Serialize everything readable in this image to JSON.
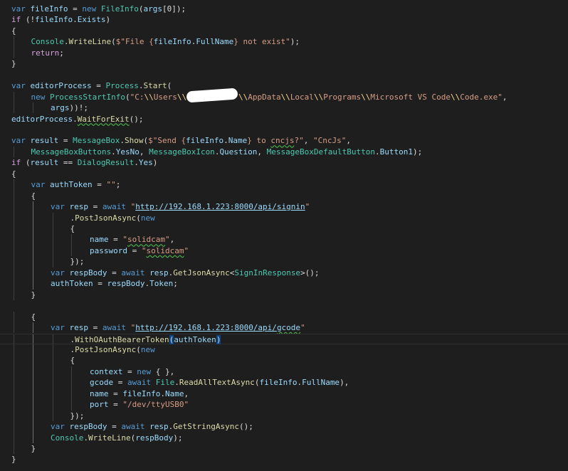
{
  "editor": {
    "lines": [
      {
        "i": 0,
        "t": [
          [
            "kw",
            "var "
          ],
          [
            "var",
            "fileInfo"
          ],
          [
            "def",
            " = "
          ],
          [
            "kw",
            "new "
          ],
          [
            "type",
            "FileInfo"
          ],
          [
            "def",
            "("
          ],
          [
            "var",
            "args"
          ],
          [
            "def",
            "[0]);"
          ]
        ]
      },
      {
        "i": 0,
        "t": [
          [
            "ctl",
            "if "
          ],
          [
            "def",
            "(!"
          ],
          [
            "var",
            "fileInfo"
          ],
          [
            "def",
            "."
          ],
          [
            "var",
            "Exists"
          ],
          [
            "def",
            ")"
          ]
        ]
      },
      {
        "i": 0,
        "t": [
          [
            "def",
            "{"
          ]
        ]
      },
      {
        "i": 1,
        "t": [
          [
            "type",
            "Console"
          ],
          [
            "def",
            "."
          ],
          [
            "meth",
            "WriteLine"
          ],
          [
            "def",
            "("
          ],
          [
            "str",
            "$\"File {"
          ],
          [
            "var",
            "fileInfo"
          ],
          [
            "def",
            "."
          ],
          [
            "var",
            "FullName"
          ],
          [
            "str",
            "} not exist\""
          ],
          [
            "def",
            ");"
          ]
        ]
      },
      {
        "i": 1,
        "t": [
          [
            "ctl",
            "return"
          ],
          [
            "def",
            ";"
          ]
        ]
      },
      {
        "i": 0,
        "t": [
          [
            "def",
            "}"
          ]
        ]
      },
      {
        "i": 0,
        "t": []
      },
      {
        "i": 0,
        "t": [
          [
            "kw",
            "var "
          ],
          [
            "var",
            "editorProcess"
          ],
          [
            "def",
            " = "
          ],
          [
            "type",
            "Process"
          ],
          [
            "def",
            "."
          ],
          [
            "meth",
            "Start"
          ],
          [
            "def",
            "("
          ]
        ]
      },
      {
        "i": 1,
        "t": [
          [
            "kw",
            "new "
          ],
          [
            "type",
            "ProcessStartInfo"
          ],
          [
            "def",
            "("
          ],
          [
            "str",
            "\"C:"
          ],
          [
            "esc",
            "\\\\"
          ],
          [
            "str",
            "Users"
          ],
          [
            "esc",
            "\\\\"
          ],
          [
            "str",
            "           "
          ],
          [
            "esc",
            "\\\\"
          ],
          [
            "str",
            "AppData"
          ],
          [
            "esc",
            "\\\\"
          ],
          [
            "str",
            "Local"
          ],
          [
            "esc",
            "\\\\"
          ],
          [
            "str",
            "Programs"
          ],
          [
            "esc",
            "\\\\"
          ],
          [
            "str",
            "Microsoft VS Code"
          ],
          [
            "esc",
            "\\\\"
          ],
          [
            "str",
            "Code.exe\""
          ],
          [
            "def",
            ","
          ]
        ]
      },
      {
        "i": 2,
        "t": [
          [
            "var",
            "args"
          ],
          [
            "def",
            "))!;"
          ]
        ]
      },
      {
        "i": 0,
        "t": [
          [
            "var",
            "editorProcess"
          ],
          [
            "def",
            "."
          ],
          [
            "meth",
            "WaitForExit",
            "squig"
          ],
          [
            "def",
            "();"
          ]
        ]
      },
      {
        "i": 0,
        "t": []
      },
      {
        "i": 0,
        "t": [
          [
            "kw",
            "var "
          ],
          [
            "var",
            "result"
          ],
          [
            "def",
            " = "
          ],
          [
            "type",
            "MessageBox"
          ],
          [
            "def",
            "."
          ],
          [
            "meth",
            "Show"
          ],
          [
            "def",
            "("
          ],
          [
            "str",
            "$\"Send {"
          ],
          [
            "var",
            "fileInfo"
          ],
          [
            "def",
            "."
          ],
          [
            "var",
            "Name"
          ],
          [
            "str",
            "} to "
          ],
          [
            "str",
            "cncjs",
            "squig"
          ],
          [
            "str",
            "?\""
          ],
          [
            "def",
            ", "
          ],
          [
            "str",
            "\"CncJs\""
          ],
          [
            "def",
            ","
          ]
        ]
      },
      {
        "i": 1,
        "t": [
          [
            "type",
            "MessageBoxButtons"
          ],
          [
            "def",
            "."
          ],
          [
            "var",
            "YesNo"
          ],
          [
            "def",
            ", "
          ],
          [
            "type",
            "MessageBoxIcon"
          ],
          [
            "def",
            "."
          ],
          [
            "var",
            "Question"
          ],
          [
            "def",
            ", "
          ],
          [
            "type",
            "MessageBoxDefaultButton"
          ],
          [
            "def",
            "."
          ],
          [
            "var",
            "Button1"
          ],
          [
            "def",
            ");"
          ]
        ]
      },
      {
        "i": 0,
        "t": [
          [
            "ctl",
            "if "
          ],
          [
            "def",
            "("
          ],
          [
            "var",
            "result"
          ],
          [
            "def",
            " == "
          ],
          [
            "type",
            "DialogResult"
          ],
          [
            "def",
            "."
          ],
          [
            "var",
            "Yes"
          ],
          [
            "def",
            ")"
          ]
        ]
      },
      {
        "i": 0,
        "t": [
          [
            "def",
            "{"
          ]
        ]
      },
      {
        "i": 1,
        "t": [
          [
            "kw",
            "var "
          ],
          [
            "var",
            "authToken"
          ],
          [
            "def",
            " = "
          ],
          [
            "str",
            "\"\""
          ],
          [
            "def",
            ";"
          ]
        ]
      },
      {
        "i": 1,
        "t": [
          [
            "def",
            "{"
          ]
        ]
      },
      {
        "i": 2,
        "t": [
          [
            "kw",
            "var "
          ],
          [
            "var",
            "resp"
          ],
          [
            "def",
            " = "
          ],
          [
            "kw",
            "await "
          ],
          [
            "str",
            "\""
          ],
          [
            "url",
            "http://192.168.1.223:8000/api/signin"
          ],
          [
            "str",
            "\""
          ]
        ]
      },
      {
        "i": 3,
        "t": [
          [
            "def",
            "."
          ],
          [
            "meth",
            "PostJsonAsync"
          ],
          [
            "def",
            "("
          ],
          [
            "kw",
            "new"
          ]
        ]
      },
      {
        "i": 3,
        "t": [
          [
            "def",
            "{"
          ]
        ]
      },
      {
        "i": 4,
        "t": [
          [
            "var",
            "name"
          ],
          [
            "def",
            " = "
          ],
          [
            "str",
            "\""
          ],
          [
            "str",
            "solidcam",
            "squig"
          ],
          [
            "str",
            "\""
          ],
          [
            "def",
            ","
          ]
        ]
      },
      {
        "i": 4,
        "t": [
          [
            "var",
            "password"
          ],
          [
            "def",
            " = "
          ],
          [
            "str",
            "\""
          ],
          [
            "str",
            "solidcam",
            "squig"
          ],
          [
            "str",
            "\""
          ]
        ]
      },
      {
        "i": 3,
        "t": [
          [
            "def",
            "});"
          ]
        ]
      },
      {
        "i": 2,
        "t": [
          [
            "kw",
            "var "
          ],
          [
            "var",
            "respBody"
          ],
          [
            "def",
            " = "
          ],
          [
            "kw",
            "await "
          ],
          [
            "var",
            "resp"
          ],
          [
            "def",
            "."
          ],
          [
            "meth",
            "GetJsonAsync"
          ],
          [
            "def",
            "<"
          ],
          [
            "type",
            "SignInResponse"
          ],
          [
            "def",
            ">();"
          ]
        ]
      },
      {
        "i": 2,
        "t": [
          [
            "var",
            "authToken"
          ],
          [
            "def",
            " = "
          ],
          [
            "var",
            "respBody"
          ],
          [
            "def",
            "."
          ],
          [
            "var",
            "Token"
          ],
          [
            "def",
            ";"
          ]
        ]
      },
      {
        "i": 1,
        "t": [
          [
            "def",
            "}"
          ]
        ]
      },
      {
        "i": 0,
        "t": []
      },
      {
        "i": 1,
        "t": [
          [
            "def",
            "{"
          ]
        ]
      },
      {
        "i": 2,
        "t": [
          [
            "kw",
            "var "
          ],
          [
            "var",
            "resp"
          ],
          [
            "def",
            " = "
          ],
          [
            "kw",
            "await "
          ],
          [
            "str",
            "\""
          ],
          [
            "url",
            "http://192.168.1.223:8000/api/"
          ],
          [
            "url",
            "gcode",
            "squig"
          ],
          [
            "str",
            "\""
          ]
        ]
      },
      {
        "i": 3,
        "cur": true,
        "t": [
          [
            "def",
            "."
          ],
          [
            "meth",
            "WithOAuthBearerToken"
          ],
          [
            "brace",
            "("
          ],
          [
            "var",
            "authToken"
          ],
          [
            "brace",
            ")"
          ]
        ]
      },
      {
        "i": 3,
        "t": [
          [
            "def",
            "."
          ],
          [
            "meth",
            "PostJsonAsync"
          ],
          [
            "def",
            "("
          ],
          [
            "kw",
            "new"
          ]
        ]
      },
      {
        "i": 3,
        "t": [
          [
            "def",
            "{"
          ]
        ]
      },
      {
        "i": 4,
        "t": [
          [
            "var",
            "context"
          ],
          [
            "def",
            " = "
          ],
          [
            "kw",
            "new "
          ],
          [
            "def",
            "{ },"
          ]
        ]
      },
      {
        "i": 4,
        "t": [
          [
            "var",
            "gcode"
          ],
          [
            "def",
            " = "
          ],
          [
            "kw",
            "await "
          ],
          [
            "type",
            "File"
          ],
          [
            "def",
            "."
          ],
          [
            "meth",
            "ReadAllTextAsync"
          ],
          [
            "def",
            "("
          ],
          [
            "var",
            "fileInfo"
          ],
          [
            "def",
            "."
          ],
          [
            "var",
            "FullName"
          ],
          [
            "def",
            "),"
          ]
        ]
      },
      {
        "i": 4,
        "t": [
          [
            "var",
            "name"
          ],
          [
            "def",
            " = "
          ],
          [
            "var",
            "fileInfo"
          ],
          [
            "def",
            "."
          ],
          [
            "var",
            "Name"
          ],
          [
            "def",
            ","
          ]
        ]
      },
      {
        "i": 4,
        "t": [
          [
            "var",
            "port"
          ],
          [
            "def",
            " = "
          ],
          [
            "str",
            "\"/dev/ttyUSB0\""
          ]
        ]
      },
      {
        "i": 3,
        "t": [
          [
            "def",
            "});"
          ]
        ]
      },
      {
        "i": 2,
        "t": [
          [
            "kw",
            "var "
          ],
          [
            "var",
            "respBody"
          ],
          [
            "def",
            " = "
          ],
          [
            "kw",
            "await "
          ],
          [
            "var",
            "resp"
          ],
          [
            "def",
            "."
          ],
          [
            "meth",
            "GetStringAsync"
          ],
          [
            "def",
            "();"
          ]
        ]
      },
      {
        "i": 2,
        "t": [
          [
            "type",
            "Console"
          ],
          [
            "def",
            "."
          ],
          [
            "meth",
            "WriteLine"
          ],
          [
            "def",
            "("
          ],
          [
            "var",
            "respBody"
          ],
          [
            "def",
            ");"
          ]
        ]
      },
      {
        "i": 1,
        "t": [
          [
            "def",
            "}"
          ]
        ]
      },
      {
        "i": 0,
        "t": [
          [
            "def",
            "}"
          ]
        ]
      }
    ]
  }
}
